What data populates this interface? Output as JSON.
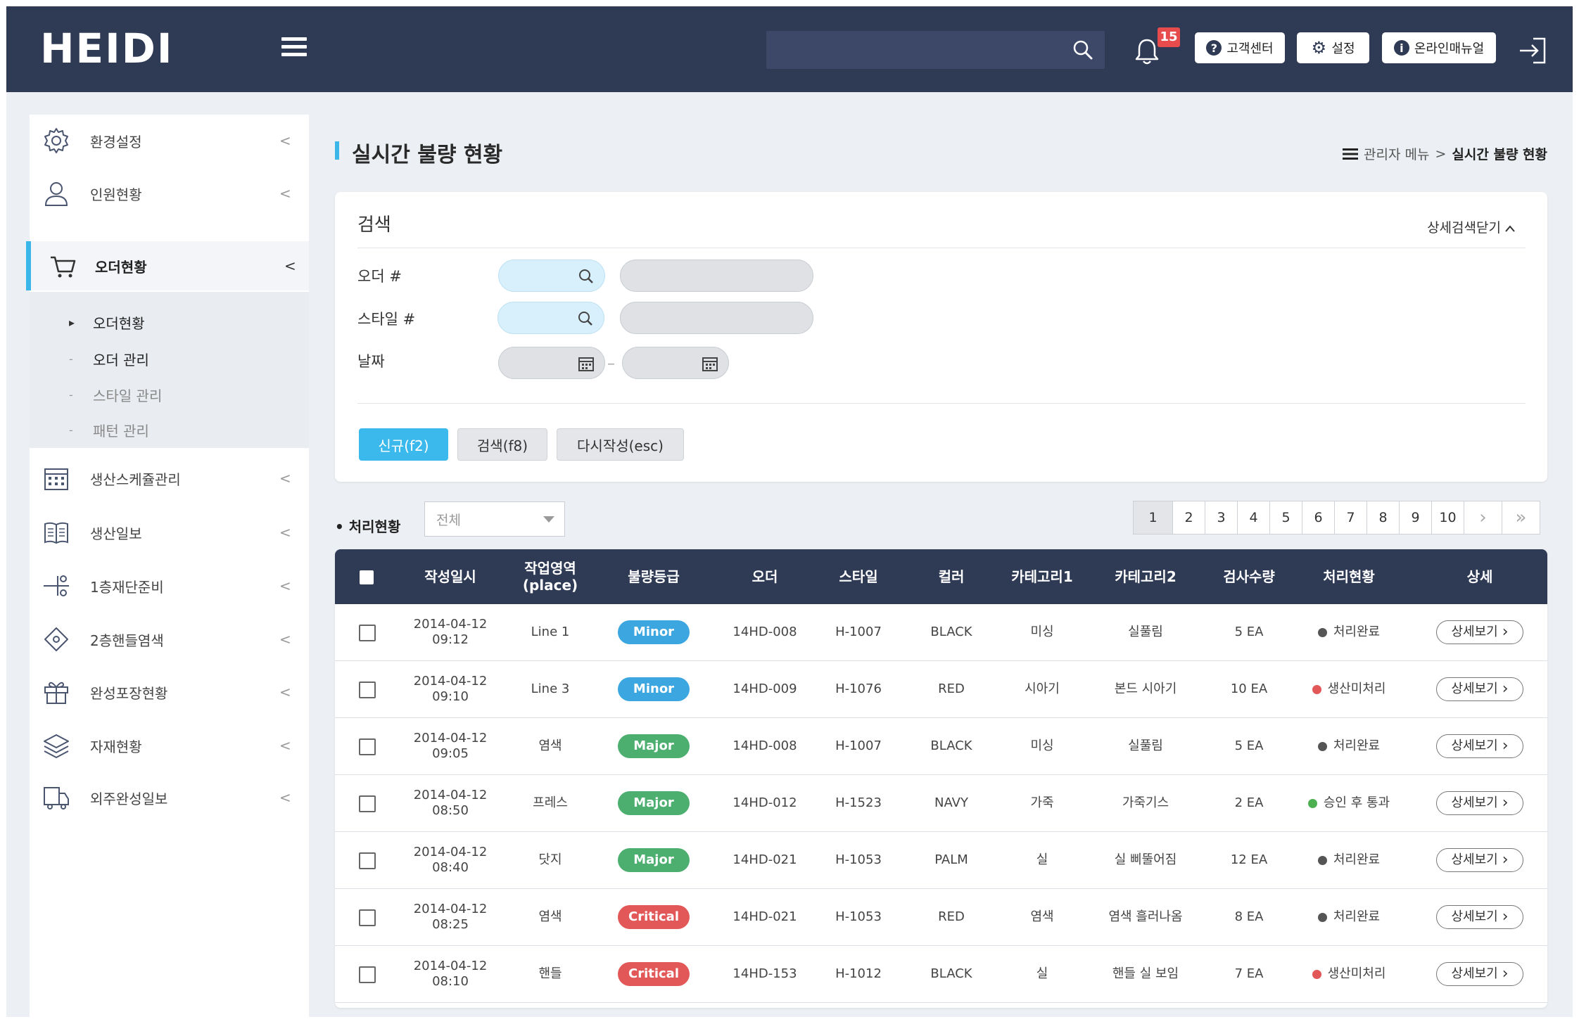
{
  "colors": {
    "header": "#2f3a55",
    "accent": "#3ab7e8",
    "minor": "#3ca6e0",
    "major": "#4caf70",
    "critical": "#e25757",
    "status_done": "#555555",
    "status_pending": "#e25757",
    "status_pass": "#4caf50"
  },
  "header": {
    "logo": "HEIDI",
    "search_placeholder": "",
    "notification_count": "15",
    "buttons": [
      {
        "icon": "question-icon",
        "glyph": "?",
        "label": "고객센터"
      },
      {
        "icon": "gear-icon",
        "glyph": "⚙",
        "label": "설정"
      },
      {
        "icon": "info-icon",
        "glyph": "i",
        "label": "온라인매뉴얼"
      }
    ]
  },
  "sidebar": {
    "items": [
      {
        "label": "환경설정",
        "icon": "gear-icon"
      },
      {
        "label": "인원현황",
        "icon": "user-icon"
      },
      {
        "label": "오더현황",
        "icon": "cart-icon"
      },
      {
        "label": "생산스케쥴관리",
        "icon": "calendar-icon"
      },
      {
        "label": "생산일보",
        "icon": "book-icon"
      },
      {
        "label": "1층재단준비",
        "icon": "scissors-icon"
      },
      {
        "label": "2층핸들염색",
        "icon": "bucket-icon"
      },
      {
        "label": "완성포장현황",
        "icon": "gift-icon"
      },
      {
        "label": "자재현황",
        "icon": "layers-icon"
      },
      {
        "label": "외주완성일보",
        "icon": "truck-icon"
      }
    ],
    "submenu": [
      {
        "label": "오더현황",
        "mark": "▸"
      },
      {
        "label": "오더 관리",
        "mark": "-"
      },
      {
        "label": "스타일 관리",
        "mark": "-"
      },
      {
        "label": "패턴 관리",
        "mark": "-"
      }
    ],
    "chevron": "<"
  },
  "page": {
    "title": "실시간 불량 현황",
    "breadcrumb": {
      "parent": "관리자 메뉴",
      "separator": ">",
      "current": "실시간 불량 현황"
    }
  },
  "search": {
    "title": "검색",
    "toggle_label": "상세검색닫기",
    "fields": [
      {
        "label": "오더 #",
        "value": "",
        "extra": ""
      },
      {
        "label": "스타일 #",
        "value": "",
        "extra": ""
      },
      {
        "label": "날짜",
        "from": "",
        "to": ""
      }
    ],
    "date_separator": "–",
    "buttons": {
      "new": "신규(f2)",
      "search": "검색(f8)",
      "reset": "다시작성(esc)"
    }
  },
  "filter": {
    "label": "처리현황",
    "selected": "전체"
  },
  "pagination": {
    "pages": [
      "1",
      "2",
      "3",
      "4",
      "5",
      "6",
      "7",
      "8",
      "9",
      "10"
    ],
    "current": "1",
    "next": "›",
    "last": "»"
  },
  "table": {
    "headers": [
      "작성일시",
      "작업영역\n(place)",
      "불량등급",
      "오더",
      "스타일",
      "컬러",
      "카테고리1",
      "카테고리2",
      "검사수량",
      "처리현황",
      "상세"
    ],
    "detail_label": "상세보기",
    "rows": [
      {
        "date": "2014-04-12",
        "time": "09:12",
        "place": "Line 1",
        "grade": "Minor",
        "order": "14HD-008",
        "style": "H-1007",
        "color": "BLACK",
        "cat1": "미싱",
        "cat2": "실풀림",
        "qty": "5 EA",
        "status": "처리완료",
        "status_type": "done"
      },
      {
        "date": "2014-04-12",
        "time": "09:10",
        "place": "Line 3",
        "grade": "Minor",
        "order": "14HD-009",
        "style": "H-1076",
        "color": "RED",
        "cat1": "시아기",
        "cat2": "본드 시아기",
        "qty": "10 EA",
        "status": "생산미처리",
        "status_type": "pending"
      },
      {
        "date": "2014-04-12",
        "time": "09:05",
        "place": "염색",
        "grade": "Major",
        "order": "14HD-008",
        "style": "H-1007",
        "color": "BLACK",
        "cat1": "미싱",
        "cat2": "실풀림",
        "qty": "5 EA",
        "status": "처리완료",
        "status_type": "done"
      },
      {
        "date": "2014-04-12",
        "time": "08:50",
        "place": "프레스",
        "grade": "Major",
        "order": "14HD-012",
        "style": "H-1523",
        "color": "NAVY",
        "cat1": "가죽",
        "cat2": "가죽기스",
        "qty": "2 EA",
        "status": "승인 후 통과",
        "status_type": "pass"
      },
      {
        "date": "2014-04-12",
        "time": "08:40",
        "place": "닷지",
        "grade": "Major",
        "order": "14HD-021",
        "style": "H-1053",
        "color": "PALM",
        "cat1": "실",
        "cat2": "실 삐뚤어짐",
        "qty": "12 EA",
        "status": "처리완료",
        "status_type": "done"
      },
      {
        "date": "2014-04-12",
        "time": "08:25",
        "place": "염색",
        "grade": "Critical",
        "order": "14HD-021",
        "style": "H-1053",
        "color": "RED",
        "cat1": "염색",
        "cat2": "염색 흘러나옴",
        "qty": "8 EA",
        "status": "처리완료",
        "status_type": "done"
      },
      {
        "date": "2014-04-12",
        "time": "08:10",
        "place": "핸들",
        "grade": "Critical",
        "order": "14HD-153",
        "style": "H-1012",
        "color": "BLACK",
        "cat1": "실",
        "cat2": "핸들 실 보임",
        "qty": "7 EA",
        "status": "생산미처리",
        "status_type": "pending"
      }
    ]
  }
}
